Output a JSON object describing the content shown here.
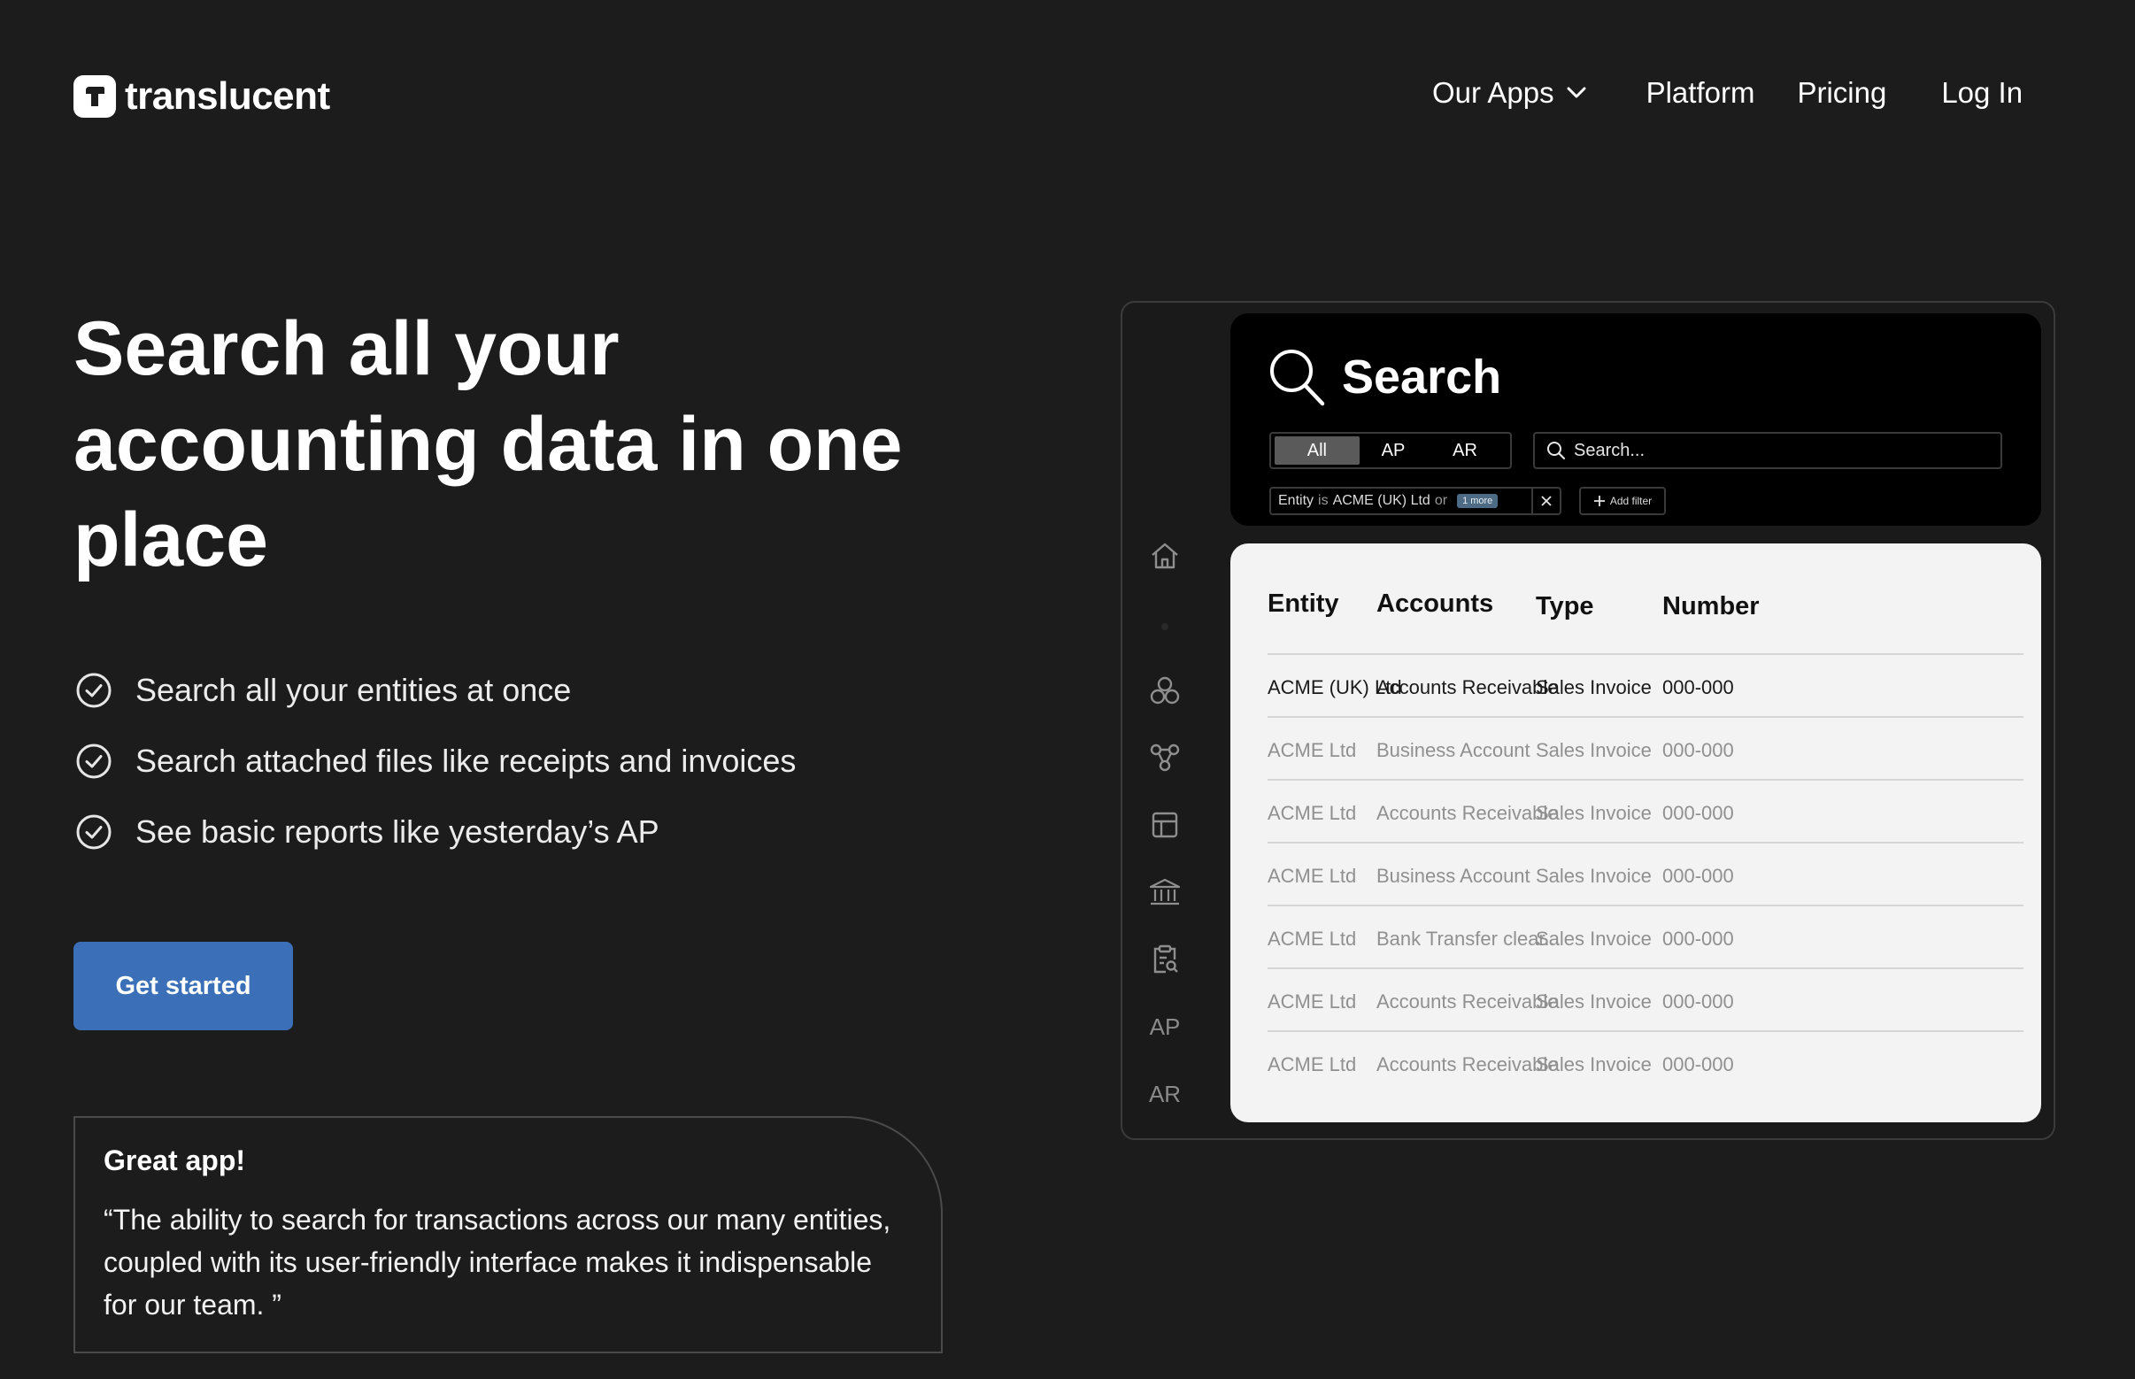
{
  "brand": {
    "name": "translucent"
  },
  "nav": {
    "apps_label": "Our Apps",
    "platform_label": "Platform",
    "pricing_label": "Pricing",
    "login_label": "Log In"
  },
  "hero": {
    "title": "Search all your accounting data in one place",
    "features": [
      "Search all your entities at once",
      "Search attached files like receipts and invoices",
      "See basic reports like yesterday’s AP"
    ],
    "cta_label": "Get started"
  },
  "testimonial": {
    "title": "Great app!",
    "quote": "“The ability to search for transactions across our many entities, coupled with its user-friendly interface makes it indispensable for our team. ”"
  },
  "mockup": {
    "sidebar": {
      "ap_label": "AP",
      "ar_label": "AR"
    },
    "search": {
      "heading": "Search",
      "segments": [
        "All",
        "AP",
        "AR"
      ],
      "selected_segment": "All",
      "placeholder": "Search...",
      "filter": {
        "field": "Entity",
        "op": "is",
        "value": "ACME (UK) Ltd",
        "joiner": "or",
        "more": "1 more"
      },
      "add_filter_label": "Add filter"
    },
    "table": {
      "columns": [
        "Entity",
        "Accounts",
        "Type",
        "Number"
      ],
      "rows": [
        [
          "ACME (UK) Ltd",
          "Accounts Receivable",
          "Sales Invoice",
          "000-000"
        ],
        [
          "ACME Ltd",
          "Business Account",
          "Sales Invoice",
          "000-000"
        ],
        [
          "ACME Ltd",
          "Accounts Receivable",
          "Sales Invoice",
          "000-000"
        ],
        [
          "ACME Ltd",
          "Business Account",
          "Sales Invoice",
          "000-000"
        ],
        [
          "ACME Ltd",
          "Bank Transfer clear...",
          "Sales Invoice",
          "000-000"
        ],
        [
          "ACME Ltd",
          "Accounts Receivable",
          "Sales Invoice",
          "000-000"
        ],
        [
          "ACME Ltd",
          "Accounts Receivable",
          "Sales Invoice",
          "000-000"
        ]
      ]
    }
  },
  "colors": {
    "background": "#1c1c1c",
    "cta": "#3b70b8",
    "panel_dark": "#000000",
    "panel_light": "#f3f3f3"
  }
}
